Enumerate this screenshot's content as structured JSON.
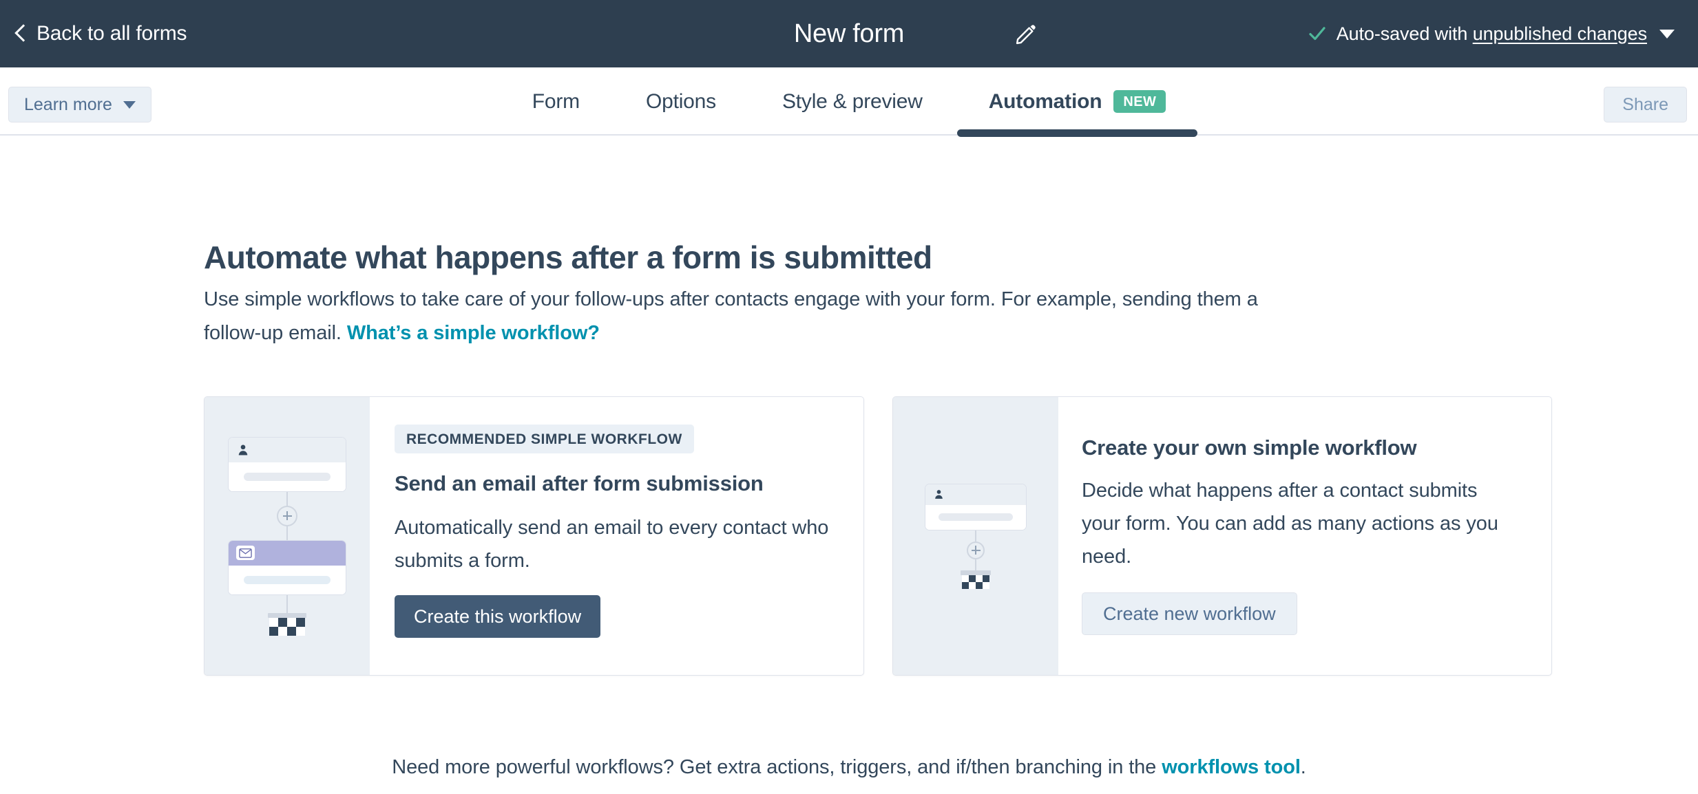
{
  "topbar": {
    "back_label": "Back to all forms",
    "back_icon": "chevron-left-icon",
    "form_title": "New form",
    "edit_icon": "pencil-icon",
    "check_icon": "check-icon",
    "save_prefix": "Auto-saved with ",
    "save_link": "unpublished changes",
    "caret_icon": "chevron-down-icon",
    "bg_color": "#2e3f50",
    "check_color": "#4fb89a"
  },
  "navbar": {
    "learn_more_label": "Learn more",
    "learn_more_caret": "chevron-down-icon",
    "share_label": "Share",
    "tabs": [
      {
        "label": "Form",
        "active": false
      },
      {
        "label": "Options",
        "active": false
      },
      {
        "label": "Style & preview",
        "active": false
      },
      {
        "label": "Automation",
        "active": true,
        "badge": "NEW"
      }
    ],
    "active_indicator_color": "#33475b",
    "badge_color": "#4fb89a"
  },
  "main": {
    "headline": "Automate what happens after a form is submitted",
    "subtext": "Use simple workflows to take care of your follow-ups after contacts engage with your form. For example, sending them a follow-up email.",
    "subtext_link": "What’s a simple workflow?",
    "link_color": "#0091ae"
  },
  "cards": [
    {
      "badge": "RECOMMENDED SIMPLE WORKFLOW",
      "title": "Send an email after form submission",
      "description": "Automatically send an email to every contact who submits a form.",
      "button_label": "Create this workflow",
      "button_style": "primary",
      "illustration": "workflow-diagram-contact-email-end",
      "illustration_bg": "#eaeff4",
      "node_icons": [
        "contact-icon",
        "envelope-icon",
        "checkered-flag-icon"
      ],
      "email_node_color": "#b0b2dd"
    },
    {
      "badge": null,
      "title": "Create your own simple workflow",
      "description": "Decide what happens after a contact submits your form. You can add as many actions as you need.",
      "button_label": "Create new workflow",
      "button_style": "secondary",
      "illustration": "workflow-diagram-contact-end",
      "illustration_bg": "#eaeff4",
      "node_icons": [
        "contact-icon",
        "checkered-flag-icon"
      ]
    }
  ],
  "footer": {
    "text_before": "Need more powerful workflows? Get extra actions, triggers, and if/then branching in the ",
    "link": "workflows tool",
    "text_after": "."
  }
}
